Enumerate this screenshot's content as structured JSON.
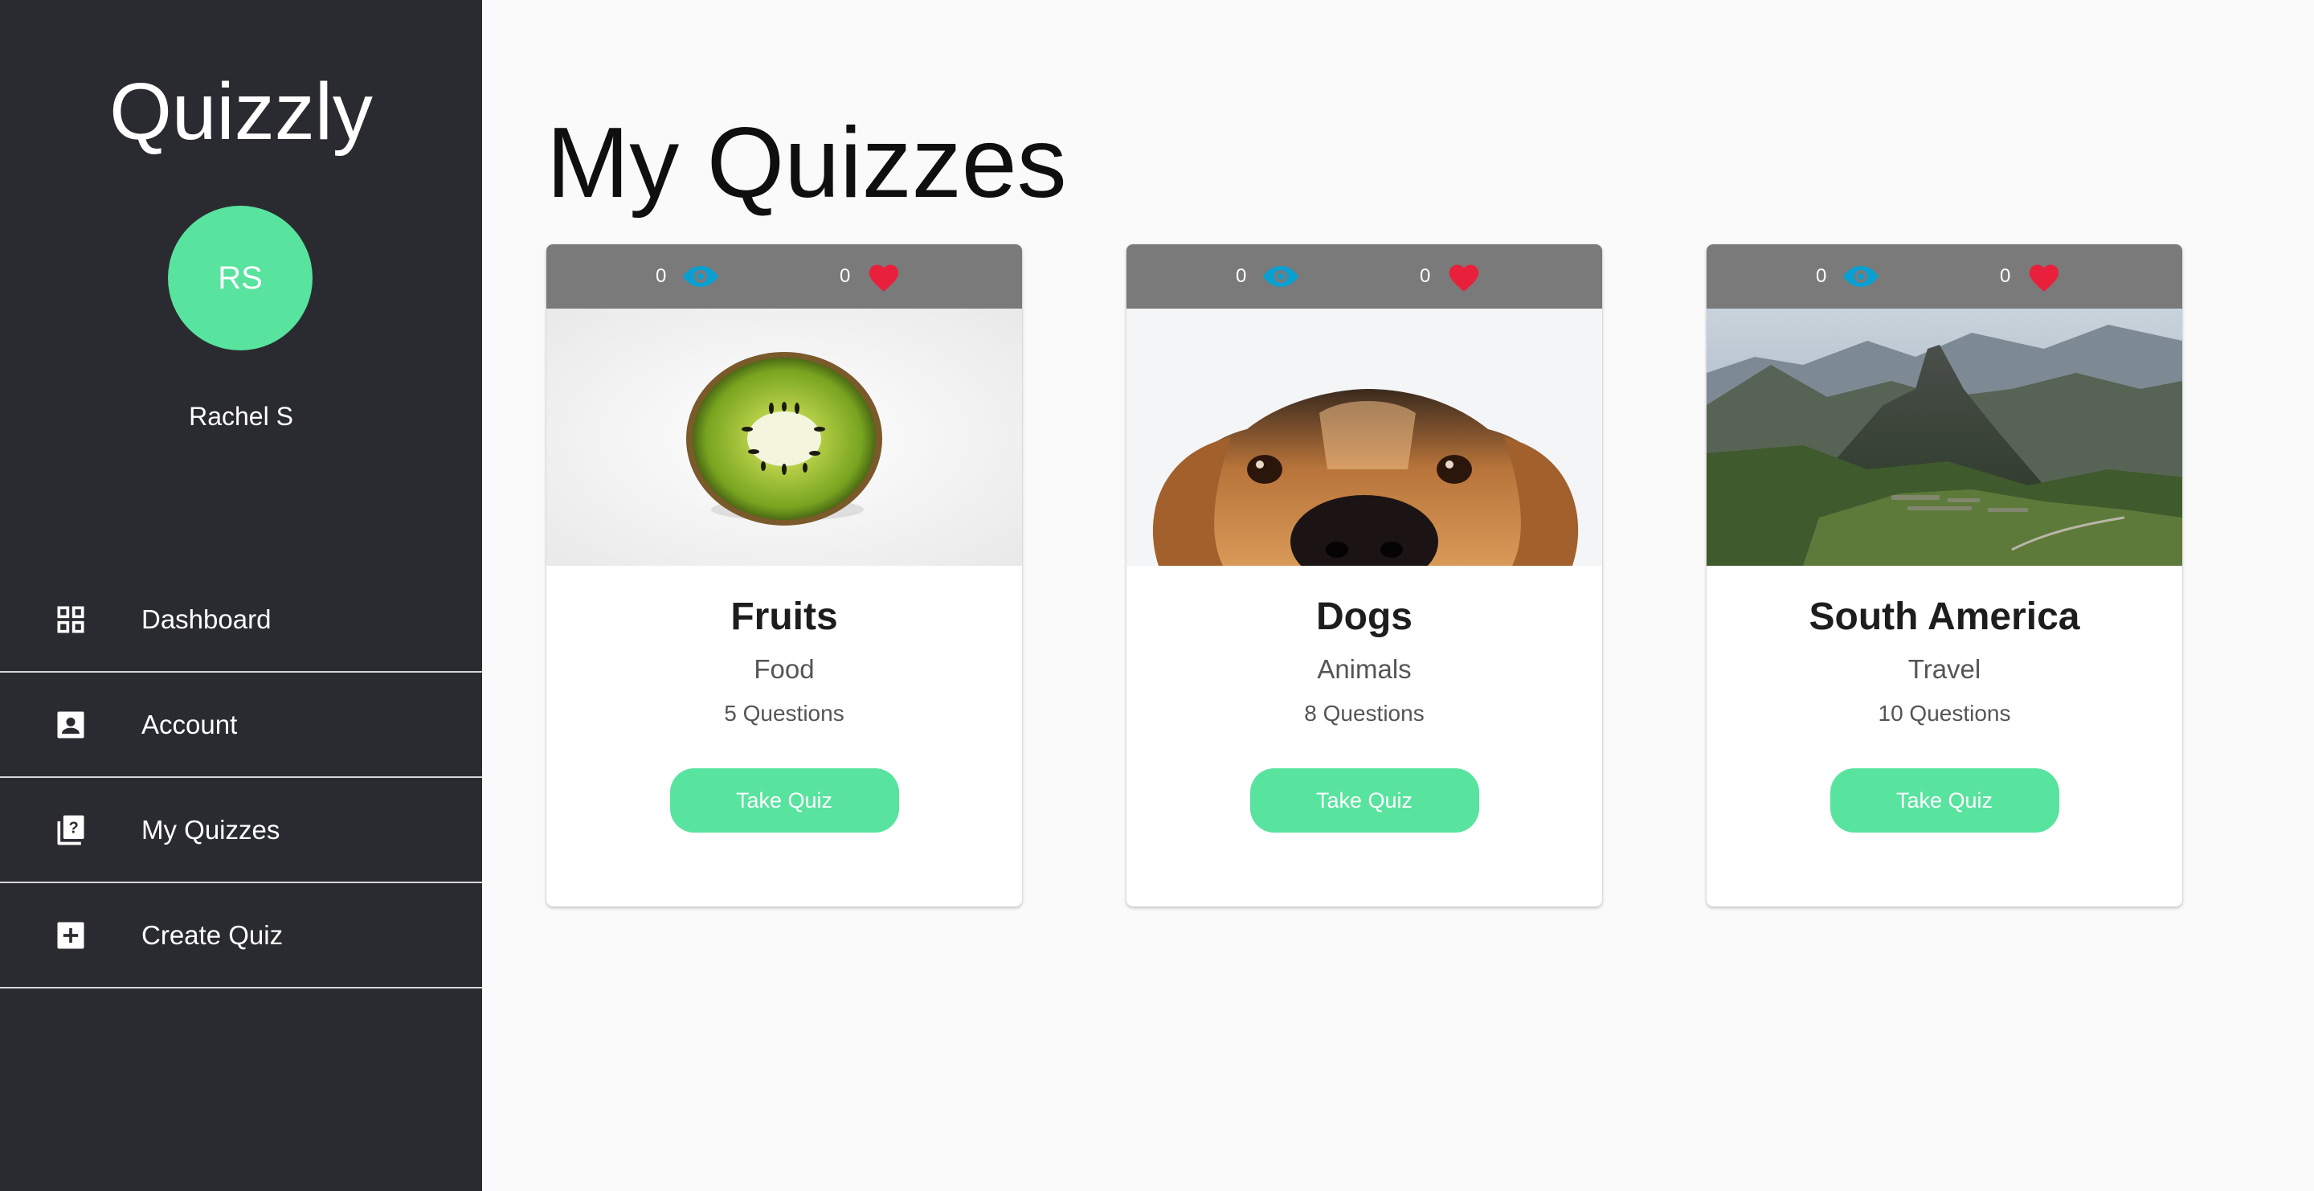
{
  "sidebar": {
    "brand": "Quizzly",
    "avatar_initials": "RS",
    "user_name": "Rachel S",
    "items": [
      {
        "label": "Dashboard",
        "icon": "dashboard-grid-icon"
      },
      {
        "label": "Account",
        "icon": "account-box-icon"
      },
      {
        "label": "My Quizzes",
        "icon": "library-question-icon"
      },
      {
        "label": "Create Quiz",
        "icon": "add-box-icon"
      }
    ]
  },
  "main": {
    "title": "My Quizzes",
    "quizzes": [
      {
        "views": "0",
        "likes": "0",
        "title": "Fruits",
        "category": "Food",
        "questions": "5 Questions",
        "button": "Take Quiz",
        "image": "kiwi-photo"
      },
      {
        "views": "0",
        "likes": "0",
        "title": "Dogs",
        "category": "Animals",
        "questions": "8 Questions",
        "button": "Take Quiz",
        "image": "dog-photo"
      },
      {
        "views": "0",
        "likes": "0",
        "title": "South America",
        "category": "Travel",
        "questions": "10 Questions",
        "button": "Take Quiz",
        "image": "machu-picchu-photo"
      }
    ]
  },
  "colors": {
    "sidebar_bg": "#2a2b31",
    "accent": "#58e39e",
    "eye_icon": "#0a9fd1",
    "heart_icon": "#e9203c",
    "stats_bar": "#7a7a7a"
  }
}
